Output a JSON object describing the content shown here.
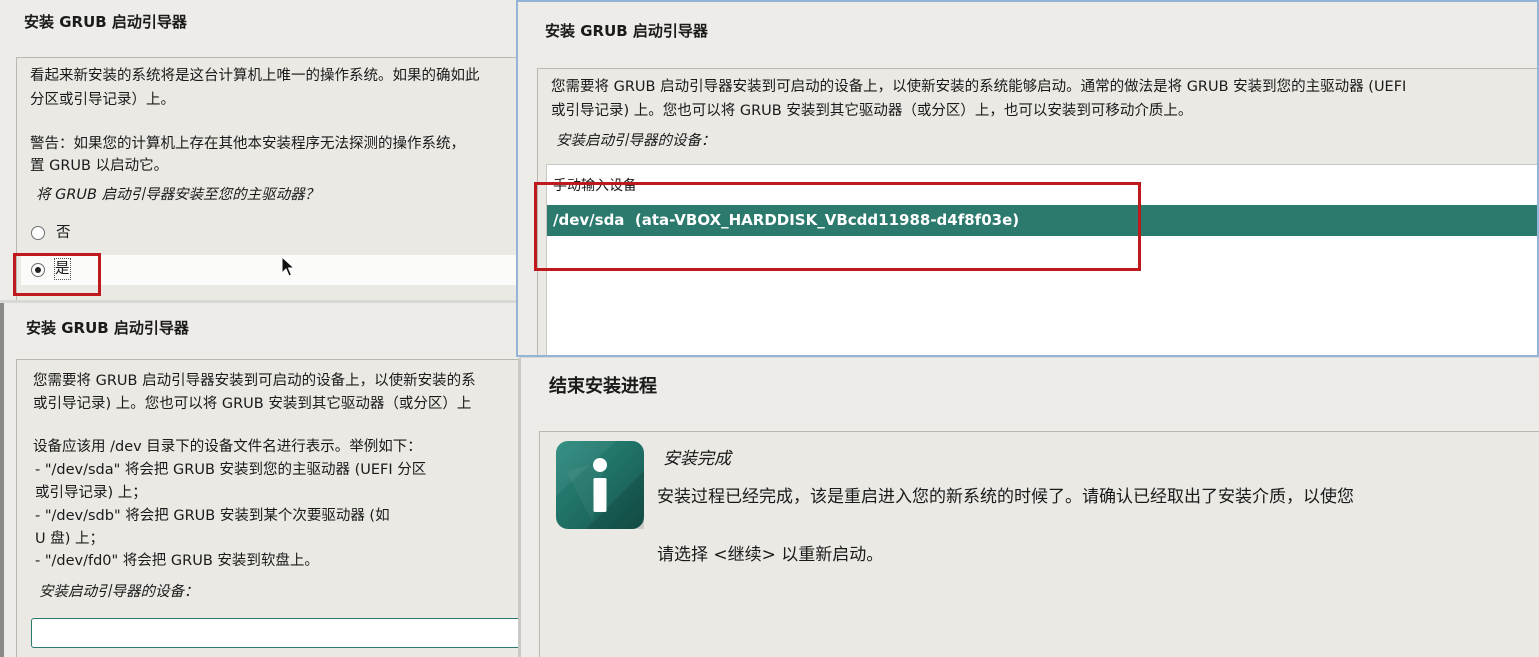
{
  "panel1": {
    "title": "安装 GRUB 启动引导器",
    "desc_line1": "看起来新安装的系统将是这台计算机上唯一的操作系统。如果的确如此",
    "desc_line2": "分区或引导记录）上。",
    "warn_line1": "警告：如果您的计算机上存在其他本安装程序无法探测的操作系统，",
    "warn_line2": "置 GRUB 以启动它。",
    "question": "将 GRUB 启动引导器安装至您的主驱动器？",
    "option_no": "否",
    "option_yes": "是",
    "selected": "是"
  },
  "panel2": {
    "title": "安装 GRUB 启动引导器",
    "desc_line1": "您需要将 GRUB 启动引导器安装到可启动的设备上，以使新安装的系统能够启动。通常的做法是将 GRUB 安装到您的主驱动器 (UEFI",
    "desc_line2": "或引导记录) 上。您也可以将 GRUB 安装到其它驱动器（或分区）上，也可以安装到可移动介质上。",
    "device_label": "安装启动引导器的设备：",
    "list_items": [
      "手动输入设备",
      "/dev/sda  (ata-VBOX_HARDDISK_VBcdd11988-d4f8f03e)"
    ],
    "selected_index": 1
  },
  "panel3": {
    "title": "安装 GRUB 启动引导器",
    "desc_line1": "您需要将 GRUB 启动引导器安装到可启动的设备上，以使新安装的系",
    "desc_line2": "或引导记录) 上。您也可以将 GRUB 安装到其它驱动器（或分区）上",
    "device_intro": "设备应该用 /dev 目录下的设备文件名进行表示。举例如下：",
    "examples": [
      "- \"/dev/sda\" 将会把 GRUB 安装到您的主驱动器 (UEFI 分区",
      "  或引导记录) 上；",
      "- \"/dev/sdb\" 将会把 GRUB 安装到某个次要驱动器 (如",
      "  U 盘) 上；",
      "- \"/dev/fd0\" 将会把 GRUB 安装到软盘上。"
    ],
    "device_label": "安装启动引导器的设备：",
    "device_input_value": ""
  },
  "panel4": {
    "title": "结束安装进程",
    "subtitle": "安装完成",
    "message": "安装过程已经完成，该是重启进入您的新系统的时候了。请确认已经取出了安装介质，以使您",
    "instruction": "请选择 <继续> 以重新启动。",
    "icon": "info-icon"
  },
  "colors": {
    "accent": "#2c7a6d",
    "highlight": "#c0191d",
    "panel_bg": "#edece8"
  }
}
